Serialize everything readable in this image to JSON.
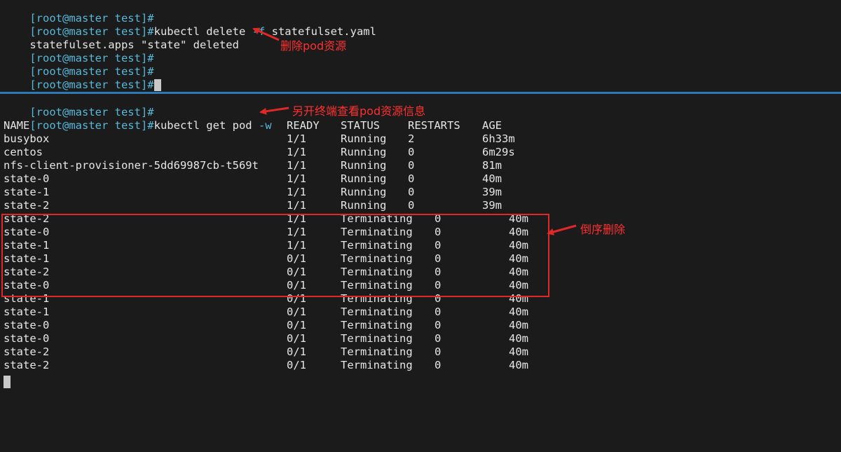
{
  "prompt": "[root@master test]#",
  "top_pane": {
    "cmd_delete_pre": "kubectl delete ",
    "cmd_delete_flag": "-f",
    "cmd_delete_post": " statefulset.yaml",
    "deleted_msg": "statefulset.apps \"state\" deleted"
  },
  "bottom_pane": {
    "cmd_get_pre": "kubectl get pod ",
    "cmd_get_flag": "-w",
    "headers": {
      "name": "NAME",
      "ready": "READY",
      "status": "STATUS",
      "restarts": "RESTARTS",
      "age": "AGE"
    },
    "running_rows": [
      {
        "name": "busybox",
        "ready": "1/1",
        "status": "Running",
        "restarts": "2",
        "age": "6h33m"
      },
      {
        "name": "centos",
        "ready": "1/1",
        "status": "Running",
        "restarts": "0",
        "age": "6m29s"
      },
      {
        "name": "nfs-client-provisioner-5dd69987cb-t569t",
        "ready": "1/1",
        "status": "Running",
        "restarts": "0",
        "age": "81m"
      },
      {
        "name": "state-0",
        "ready": "1/1",
        "status": "Running",
        "restarts": "0",
        "age": "40m"
      },
      {
        "name": "state-1",
        "ready": "1/1",
        "status": "Running",
        "restarts": "0",
        "age": "39m"
      },
      {
        "name": "state-2",
        "ready": "1/1",
        "status": "Running",
        "restarts": "0",
        "age": "39m"
      }
    ],
    "terminating_rows": [
      {
        "name": "state-2",
        "ready": "1/1",
        "status": "Terminating",
        "restarts": "0",
        "age": "40m"
      },
      {
        "name": "state-0",
        "ready": "1/1",
        "status": "Terminating",
        "restarts": "0",
        "age": "40m"
      },
      {
        "name": "state-1",
        "ready": "1/1",
        "status": "Terminating",
        "restarts": "0",
        "age": "40m"
      },
      {
        "name": "state-1",
        "ready": "0/1",
        "status": "Terminating",
        "restarts": "0",
        "age": "40m"
      },
      {
        "name": "state-2",
        "ready": "0/1",
        "status": "Terminating",
        "restarts": "0",
        "age": "40m"
      },
      {
        "name": "state-0",
        "ready": "0/1",
        "status": "Terminating",
        "restarts": "0",
        "age": "40m"
      },
      {
        "name": "state-1",
        "ready": "0/1",
        "status": "Terminating",
        "restarts": "0",
        "age": "40m"
      },
      {
        "name": "state-1",
        "ready": "0/1",
        "status": "Terminating",
        "restarts": "0",
        "age": "40m"
      },
      {
        "name": "state-0",
        "ready": "0/1",
        "status": "Terminating",
        "restarts": "0",
        "age": "40m"
      },
      {
        "name": "state-0",
        "ready": "0/1",
        "status": "Terminating",
        "restarts": "0",
        "age": "40m"
      },
      {
        "name": "state-2",
        "ready": "0/1",
        "status": "Terminating",
        "restarts": "0",
        "age": "40m"
      },
      {
        "name": "state-2",
        "ready": "0/1",
        "status": "Terminating",
        "restarts": "0",
        "age": "40m"
      }
    ]
  },
  "annotations": {
    "delete_note": "删除pod资源",
    "watch_note": "另开终端查看pod资源信息",
    "reverse_note": "倒序删除"
  },
  "colors": {
    "background": "#1b1b1b",
    "prompt": "#58b8d8",
    "text": "#e6e6e6",
    "annotation": "#ff3030",
    "divider": "#2c78b8"
  }
}
